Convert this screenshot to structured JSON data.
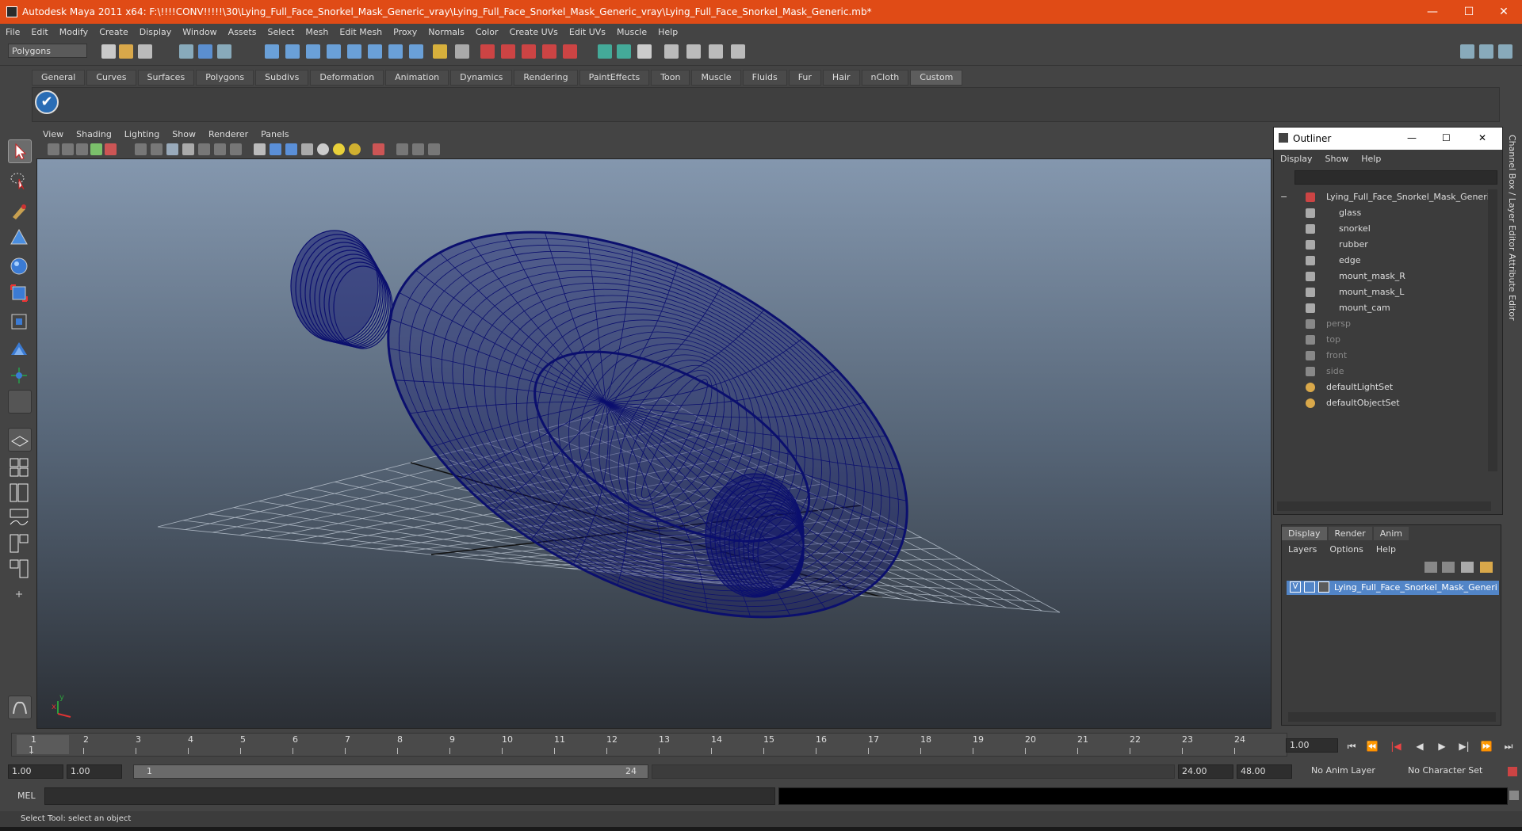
{
  "window": {
    "title": "Autodesk Maya 2011 x64: F:\\!!!!CONV!!!!!\\30\\Lying_Full_Face_Snorkel_Mask_Generic_vray\\Lying_Full_Face_Snorkel_Mask_Generic_vray\\Lying_Full_Face_Snorkel_Mask_Generic.mb*",
    "controls": {
      "minimize": "—",
      "maximize": "☐",
      "close": "✕"
    }
  },
  "menubar": [
    "File",
    "Edit",
    "Modify",
    "Create",
    "Display",
    "Window",
    "Assets",
    "Select",
    "Mesh",
    "Edit Mesh",
    "Proxy",
    "Normals",
    "Color",
    "Create UVs",
    "Edit UVs",
    "Muscle",
    "Help"
  ],
  "toolbar": {
    "mode": "Polygons"
  },
  "shelf": {
    "tabs": [
      "General",
      "Curves",
      "Surfaces",
      "Polygons",
      "Subdivs",
      "Deformation",
      "Animation",
      "Dynamics",
      "Rendering",
      "PaintEffects",
      "Toon",
      "Muscle",
      "Fluids",
      "Fur",
      "Hair",
      "nCloth",
      "Custom"
    ],
    "active": "Custom",
    "check_icon": "✔"
  },
  "viewport": {
    "menus": [
      "View",
      "Shading",
      "Lighting",
      "Show",
      "Renderer",
      "Panels"
    ],
    "wire_color": "#0b0f6e",
    "axis": {
      "x": "x",
      "y": "y"
    }
  },
  "outliner": {
    "title": "Outliner",
    "menus": [
      "Display",
      "Show",
      "Help"
    ],
    "controls": {
      "minimize": "—",
      "maximize": "☐",
      "close": "✕"
    },
    "collapse_glyph": "−",
    "root": "Lying_Full_Face_Snorkel_Mask_Generic",
    "children": [
      "glass",
      "snorkel",
      "rubber",
      "edge",
      "mount_mask_R",
      "mount_mask_L",
      "mount_cam"
    ],
    "cameras": [
      "persp",
      "top",
      "front",
      "side"
    ],
    "sets": [
      "defaultLightSet",
      "defaultObjectSet"
    ]
  },
  "layer_editor": {
    "tabs": [
      "Display",
      "Render",
      "Anim"
    ],
    "active": "Display",
    "menus": [
      "Layers",
      "Options",
      "Help"
    ],
    "visibility": "V",
    "layer_name": "Lying_Full_Face_Snorkel_Mask_Generic_la"
  },
  "right_strip": {
    "channel_box": "Channel Box / Layer Editor",
    "attribute_editor": "Attribute Editor"
  },
  "timeline": {
    "ticks": [
      "1",
      "2",
      "3",
      "4",
      "5",
      "6",
      "7",
      "8",
      "9",
      "10",
      "11",
      "12",
      "13",
      "14",
      "15",
      "16",
      "17",
      "18",
      "19",
      "20",
      "21",
      "22",
      "23",
      "24"
    ],
    "current_frame": "1",
    "current_field": "1.00",
    "buttons": [
      "⏮",
      "⏪",
      "|◀",
      "◀",
      "▶",
      "▶|",
      "⏩",
      "⏭"
    ]
  },
  "range": {
    "start": "1.00",
    "playback_start": "1.00",
    "slider_start": "1",
    "slider_end": "24",
    "playback_end": "24.00",
    "end": "48.00",
    "anim_layer": "No Anim Layer",
    "character_set": "No Character Set"
  },
  "command": {
    "label": "MEL"
  },
  "help_line": "Select Tool: select an object"
}
